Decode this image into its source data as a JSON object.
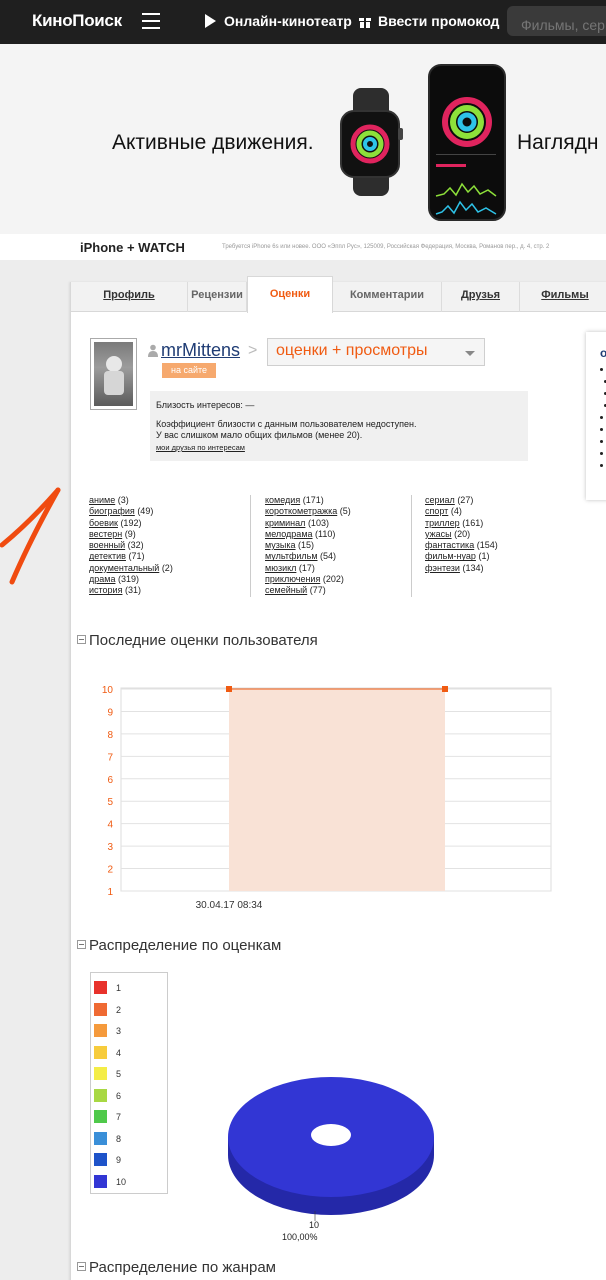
{
  "topbar": {
    "logo": "КиноПоиск",
    "online_cinema": "Онлайн-кинотеатр",
    "promo": "Ввести промокод",
    "search_placeholder": "Фильмы, сериалы"
  },
  "banner": {
    "text_left": "Активные движения.",
    "text_right": "Наглядн",
    "strip_logo": "iPhone + WATCH",
    "strip_fine": "Требуется iPhone 6s или новее. ООО «Эппл Рус», 125009, Российская Федерация, Москва, Романов пер., д. 4, стр. 2"
  },
  "tabs": [
    {
      "label": "Профиль",
      "state": "link"
    },
    {
      "label": "Рецензии",
      "state": "plain"
    },
    {
      "label": "Оценки",
      "state": "active"
    },
    {
      "label": "Комментарии",
      "state": "plain"
    },
    {
      "label": "Друзья",
      "state": "link"
    },
    {
      "label": "Фильмы",
      "state": "link"
    }
  ],
  "profile": {
    "username": "mrMittens",
    "mode": "оценки + просмотры",
    "online_badge": "на сайте",
    "affinity_title": "Близость интересов: —",
    "affinity_line1": "Коэффициент близости с данным пользователем недоступен.",
    "affinity_line2": "У вас слишком мало общих фильмов (менее 20).",
    "affinity_link": "мои друзья по интересам",
    "side_title": "о"
  },
  "genres": {
    "col1": [
      {
        "name": "аниме",
        "count": "(3)"
      },
      {
        "name": "биография",
        "count": "(49)"
      },
      {
        "name": "боевик",
        "count": "(192)"
      },
      {
        "name": "вестерн",
        "count": "(9)"
      },
      {
        "name": "военный",
        "count": "(32)"
      },
      {
        "name": "детектив",
        "count": "(71)"
      },
      {
        "name": "документальный",
        "count": "(2)"
      },
      {
        "name": "драма",
        "count": "(319)"
      },
      {
        "name": "история",
        "count": "(31)"
      }
    ],
    "col2": [
      {
        "name": "комедия",
        "count": "(171)"
      },
      {
        "name": "короткометражка",
        "count": "(5)"
      },
      {
        "name": "криминал",
        "count": "(103)"
      },
      {
        "name": "мелодрама",
        "count": "(110)"
      },
      {
        "name": "музыка",
        "count": "(15)"
      },
      {
        "name": "мультфильм",
        "count": "(54)"
      },
      {
        "name": "мюзикл",
        "count": "(17)"
      },
      {
        "name": "приключения",
        "count": "(202)"
      },
      {
        "name": "семейный",
        "count": "(77)"
      }
    ],
    "col3": [
      {
        "name": "сериал",
        "count": "(27)"
      },
      {
        "name": "спорт",
        "count": "(4)"
      },
      {
        "name": "триллер",
        "count": "(161)"
      },
      {
        "name": "ужасы",
        "count": "(20)"
      },
      {
        "name": "фантастика",
        "count": "(154)"
      },
      {
        "name": "фильм-нуар",
        "count": "(1)"
      },
      {
        "name": "фэнтези",
        "count": "(134)"
      }
    ]
  },
  "sections": {
    "recent": "Последние оценки пользователя",
    "distribution": "Распределение по оценкам",
    "by_genre": "Распределение по жанрам"
  },
  "colors": {
    "accent": "#f05b12",
    "link": "#1f3c74",
    "pie": "#3236d4"
  },
  "chart_data": [
    {
      "type": "area",
      "x": [
        "30.04.17 08:34"
      ],
      "values": [
        10,
        10
      ],
      "xlabel": "30.04.17 08:34",
      "ylim": [
        1,
        10
      ],
      "yticks": [
        1,
        2,
        3,
        4,
        5,
        6,
        7,
        8,
        9,
        10
      ],
      "grid": true
    },
    {
      "type": "pie",
      "categories": [
        "1",
        "2",
        "3",
        "4",
        "5",
        "6",
        "7",
        "8",
        "9",
        "10"
      ],
      "values": [
        0,
        0,
        0,
        0,
        0,
        0,
        0,
        0,
        0,
        100
      ],
      "legend_colors": [
        "#e8322b",
        "#ef6a33",
        "#f59a3c",
        "#f7cc3c",
        "#f4ed47",
        "#a8d843",
        "#4fc94a",
        "#3a8fd8",
        "#1e53c9",
        "#3236d4"
      ],
      "slice_label": "10",
      "slice_percent": "100,00%",
      "legend": "left"
    }
  ]
}
